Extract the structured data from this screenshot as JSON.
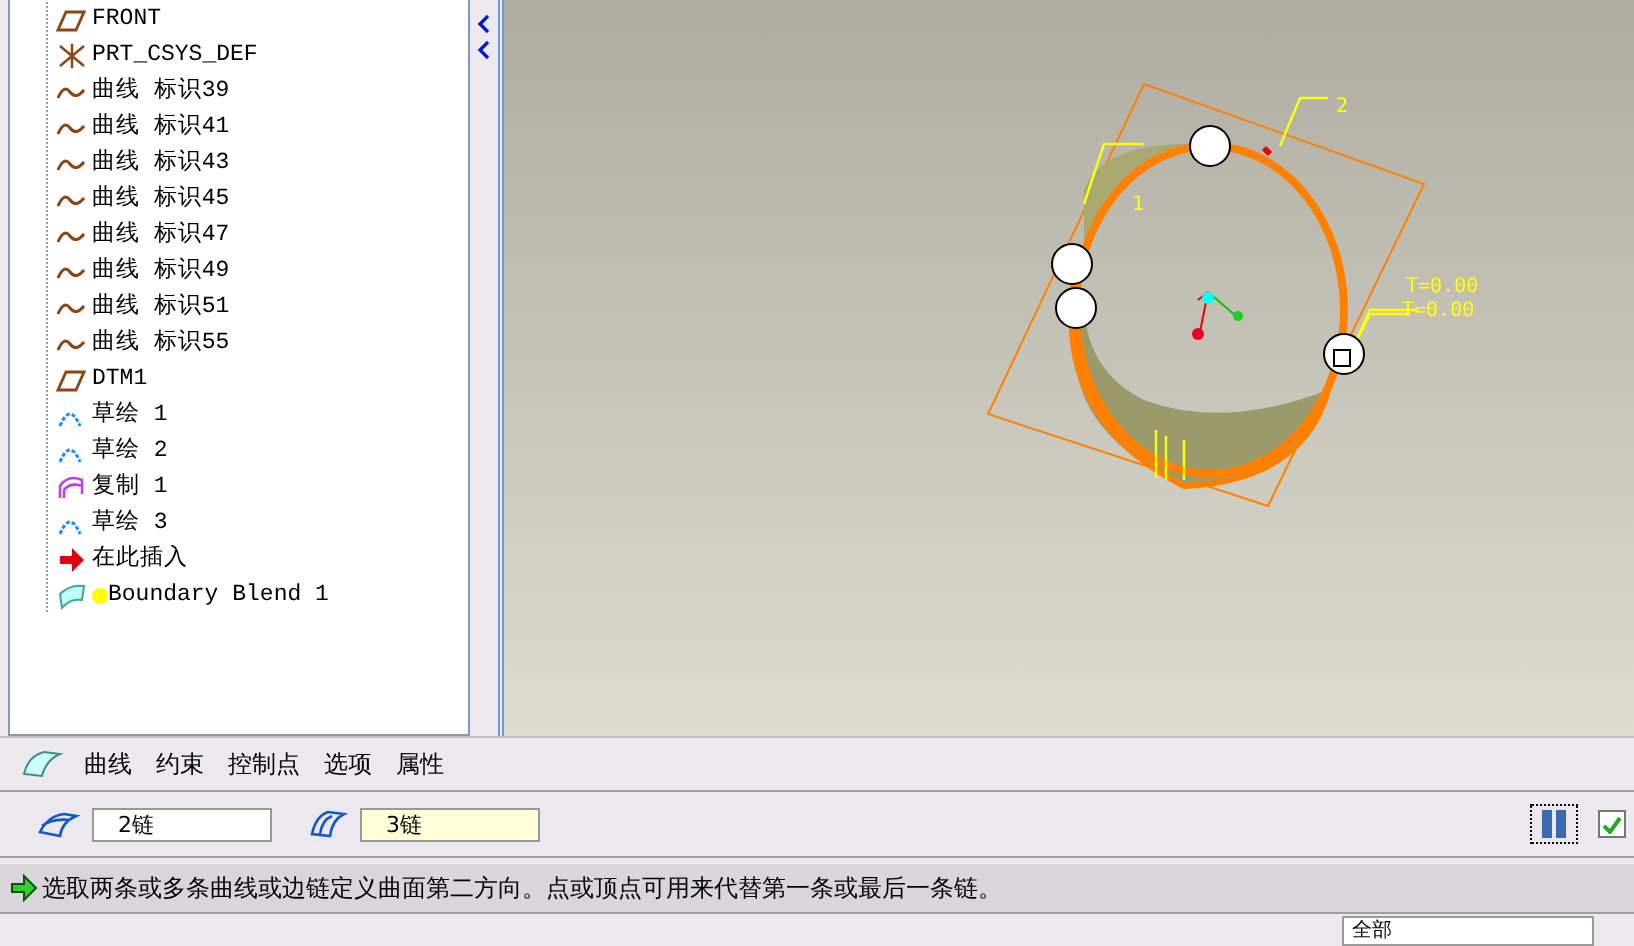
{
  "model_tree": {
    "items": [
      {
        "kind": "plane",
        "label": "FRONT"
      },
      {
        "kind": "csys",
        "label": "PRT_CSYS_DEF"
      },
      {
        "kind": "curve",
        "label": "曲线 标识39"
      },
      {
        "kind": "curve",
        "label": "曲线 标识41"
      },
      {
        "kind": "curve",
        "label": "曲线 标识43"
      },
      {
        "kind": "curve",
        "label": "曲线 标识45"
      },
      {
        "kind": "curve",
        "label": "曲线 标识47"
      },
      {
        "kind": "curve",
        "label": "曲线 标识49"
      },
      {
        "kind": "curve",
        "label": "曲线 标识51"
      },
      {
        "kind": "curve",
        "label": "曲线 标识55"
      },
      {
        "kind": "plane",
        "label": "DTM1"
      },
      {
        "kind": "sketch",
        "label": "草绘 1"
      },
      {
        "kind": "sketch",
        "label": "草绘 2"
      },
      {
        "kind": "copy",
        "label": "复制 1"
      },
      {
        "kind": "sketch",
        "label": "草绘 3"
      },
      {
        "kind": "insert",
        "label": "在此插入"
      },
      {
        "kind": "blend",
        "label": "Boundary Blend 1"
      }
    ]
  },
  "viewport": {
    "callouts": [
      {
        "text": "1"
      },
      {
        "text": "2"
      },
      {
        "text": "T=0.00"
      },
      {
        "text": "T=0.00"
      }
    ]
  },
  "dashboard": {
    "tabs": [
      {
        "label": "曲线",
        "selected": false
      },
      {
        "label": "约束",
        "selected": false
      },
      {
        "label": "控制点",
        "selected": false
      },
      {
        "label": "选项",
        "selected": false
      },
      {
        "label": "属性",
        "selected": false
      }
    ],
    "chains": [
      {
        "value": "2链",
        "selected": false
      },
      {
        "value": "3链",
        "selected": true
      }
    ],
    "preview_checked": true
  },
  "message": "选取两条或多条曲线或边链定义曲面第二方向。点或顶点可用来代替第一条或最后一条链。",
  "filter": "全部"
}
